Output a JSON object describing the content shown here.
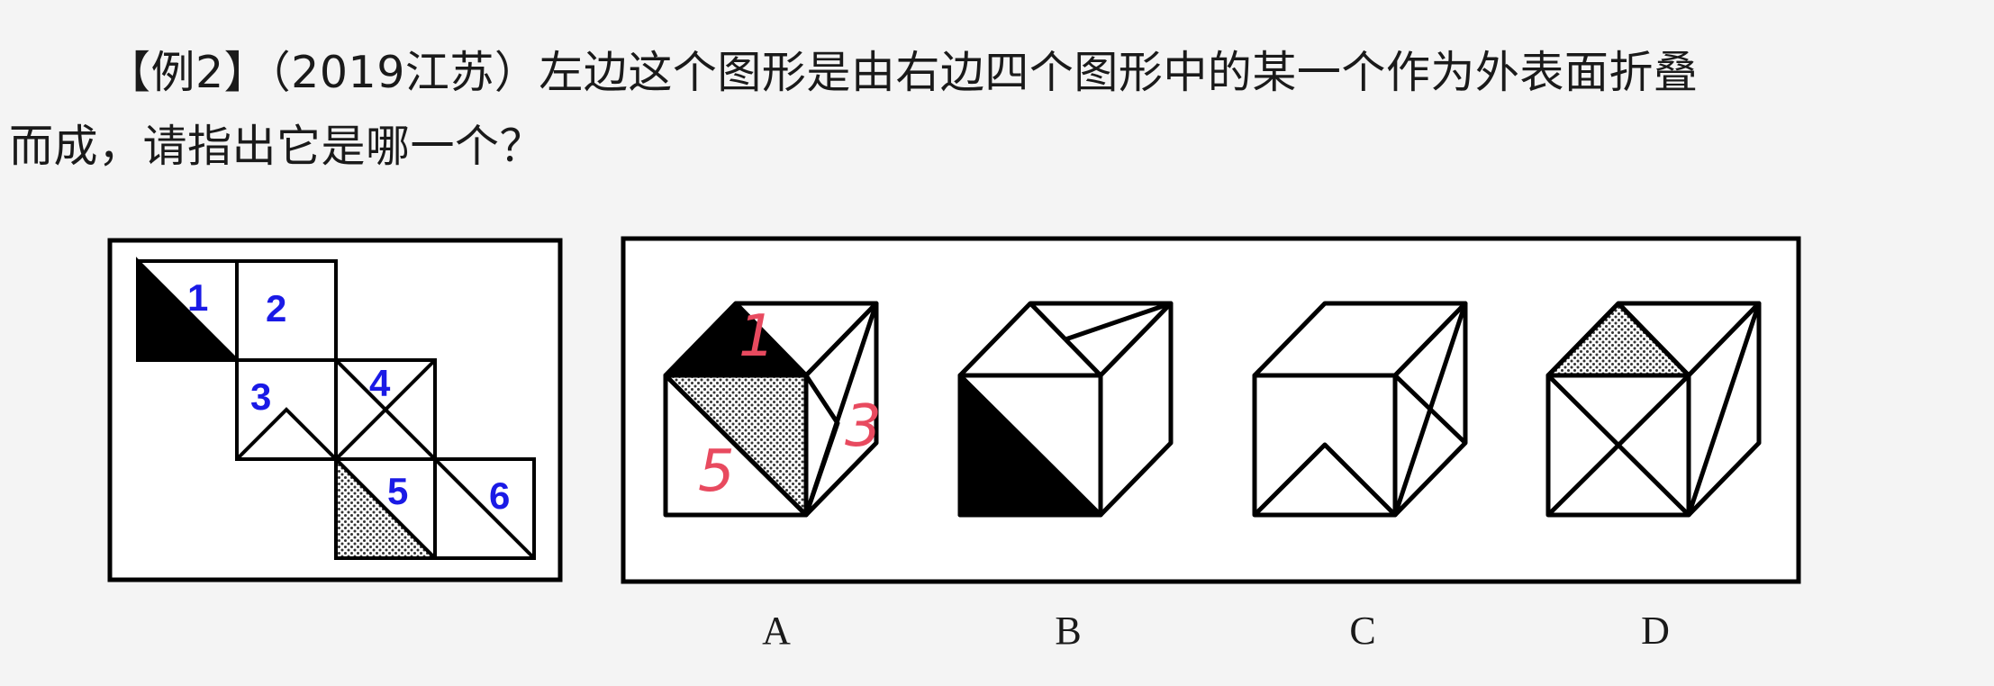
{
  "question": {
    "prefix": "【例2】（2019江苏）",
    "line1": "左边这个图形是由右边四个图形中的某一个作为外表面折叠",
    "line2": "而成，请指出它是哪一个？"
  },
  "net": {
    "face_labels": [
      "1",
      "2",
      "3",
      "4",
      "5",
      "6"
    ]
  },
  "options": {
    "labels": [
      "A",
      "B",
      "C",
      "D"
    ],
    "annotations": [
      "1",
      "3",
      "5"
    ]
  },
  "colors": {
    "face_number": "#1a1ae6",
    "annotation": "#e84a5f",
    "stroke": "#000000",
    "page": "#f4f4f4"
  }
}
